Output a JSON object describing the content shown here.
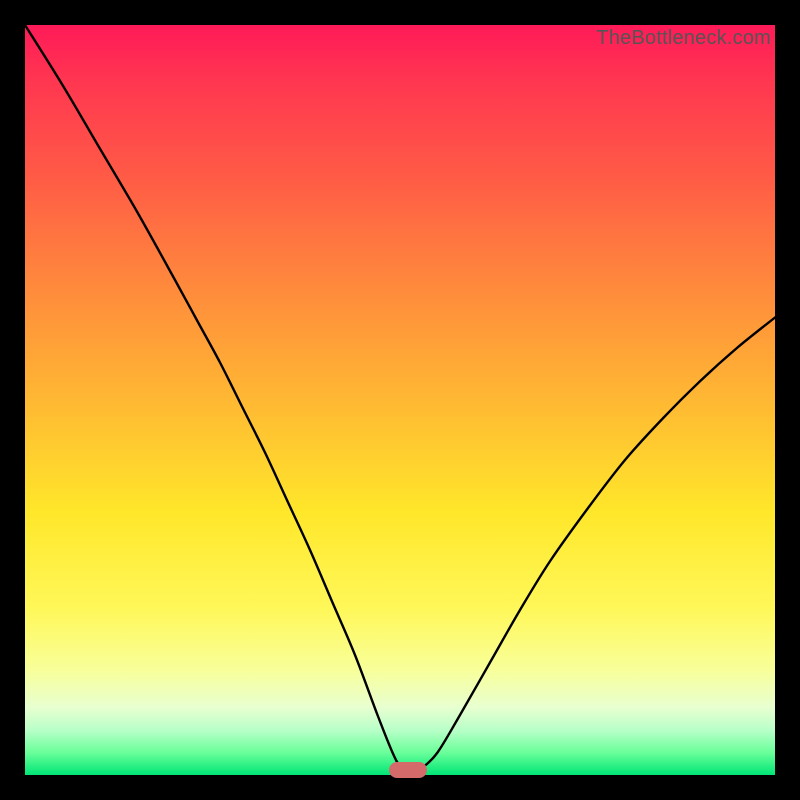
{
  "watermark": "TheBottleneck.com",
  "colors": {
    "frame": "#000000",
    "curve": "#000000",
    "marker": "#d46a6a",
    "gradient_stops": [
      "#ff1a58",
      "#ff3850",
      "#ff5a46",
      "#ff8a3c",
      "#ffb833",
      "#ffe72a",
      "#fff85a",
      "#f8ff9a",
      "#e8ffd0",
      "#b8ffc8",
      "#6aff9a",
      "#00e676"
    ]
  },
  "chart_data": {
    "type": "line",
    "title": "",
    "xlabel": "",
    "ylabel": "",
    "xlim": [
      0,
      100
    ],
    "ylim": [
      0,
      100
    ],
    "x": [
      0,
      5,
      10,
      15,
      20,
      23,
      26,
      29,
      32,
      35,
      38,
      41,
      44,
      47,
      49,
      50,
      51,
      52,
      53,
      55,
      58,
      62,
      66,
      70,
      75,
      80,
      85,
      90,
      95,
      100
    ],
    "values": [
      100,
      92,
      83.5,
      75,
      66,
      60.5,
      55,
      49,
      43,
      36.5,
      30,
      23,
      16,
      8,
      3,
      1.2,
      0.7,
      0.7,
      1.0,
      3,
      8,
      15,
      22,
      28.5,
      35.5,
      42,
      47.5,
      52.5,
      57,
      61
    ],
    "note": "x and values are normalized 0-100; curve approximates a V-shaped bottleneck plot with minimum near x≈51.",
    "marker": {
      "x": 51,
      "y": 0.7
    }
  }
}
